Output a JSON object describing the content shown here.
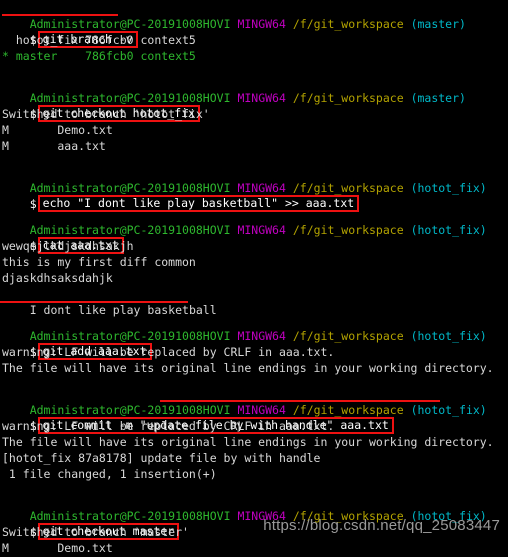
{
  "terminal": {
    "shell": "MINGW64",
    "user_host": "Administrator@PC-20191008HOVI",
    "cwd": "/f/git_workspace",
    "prompt_symbol": "$",
    "colors": {
      "background": "#000000",
      "user_host": "#2EB82E",
      "shell": "#C000C0",
      "path": "#B3A300",
      "branch": "#00B8C8",
      "output": "#D8D8D8",
      "annotation": "#EE1111",
      "watermark": "#9A9A9A"
    },
    "branches": {
      "master": "(master)",
      "hotot_fix": "(hotot_fix)"
    }
  },
  "blocks": [
    {
      "id": "block-git-branch-v",
      "branch": "(master)",
      "command": "git branch -v",
      "output": [
        "  hotot_fix 786fcb0 context5",
        "* master    786fcb0 context5"
      ]
    },
    {
      "id": "block-git-checkout-hotot-fix",
      "branch": "(master)",
      "command": "git checkout hotot_fix",
      "output": [
        "Switched to branch 'hotot_fix'",
        "M       Demo.txt",
        "M       aaa.txt"
      ]
    },
    {
      "id": "block-echo-append",
      "branch": "(hotot_fix)",
      "command": "echo \"I dont like play basketball\" >> aaa.txt",
      "output": []
    },
    {
      "id": "block-cat-aaa",
      "branch": "(hotot_fix)",
      "command": "cat aaa.txt",
      "output": [
        "wewqejlkdjskdhsakjh",
        "this is my first diff common",
        "djaskdhsaksdahjk",
        "I dont like play basketball"
      ]
    },
    {
      "id": "block-git-add",
      "branch": "(hotot_fix)",
      "command": "git add aaa.txt",
      "output": [
        "warning: LF will be replaced by CRLF in aaa.txt.",
        "The file will have its original line endings in your working directory."
      ]
    },
    {
      "id": "block-git-commit",
      "branch": "(hotot_fix)",
      "command": "git commit -m \"update file by with handle\" aaa.txt",
      "output": [
        "warning: LF will be replaced by CRLF in aaa.txt.",
        "The file will have its original line endings in your working directory.",
        "[hotot_fix 87a8178] update file by with handle",
        " 1 file changed, 1 insertion(+)"
      ]
    },
    {
      "id": "block-git-checkout-master",
      "branch": "(hotot_fix)",
      "command": "git checkout master",
      "output": [
        "Switched to branch 'master'",
        "M       Demo.txt"
      ]
    }
  ],
  "watermark": {
    "text": "https://blog.csdn.net/qq_25083447"
  }
}
